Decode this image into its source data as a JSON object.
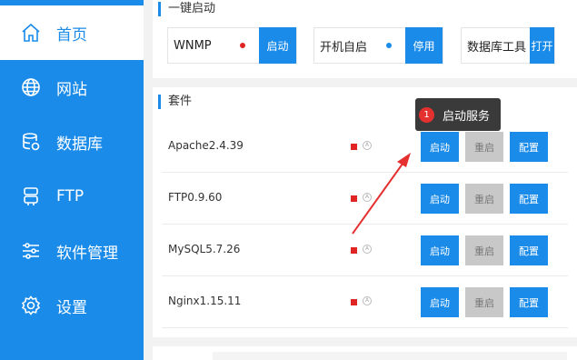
{
  "sidebar": {
    "items": [
      {
        "label": "首页",
        "icon": "home-icon",
        "active": true
      },
      {
        "label": "网站",
        "icon": "globe-icon",
        "active": false
      },
      {
        "label": "数据库",
        "icon": "database-icon",
        "active": false
      },
      {
        "label": "FTP",
        "icon": "ftp-icon",
        "active": false
      },
      {
        "label": "软件管理",
        "icon": "sliders-icon",
        "active": false
      },
      {
        "label": "设置",
        "icon": "gear-icon",
        "active": false
      }
    ]
  },
  "quick_launch": {
    "title": "一键启动",
    "groups": [
      {
        "name": "WNMP",
        "button": "启动",
        "dot_color": "#e02424"
      },
      {
        "name": "开机自启",
        "button": "停用",
        "dot_color": "#1b8be9"
      },
      {
        "name": "数据库工具",
        "button": "打开"
      }
    ]
  },
  "kits": {
    "title": "套件",
    "rows": [
      {
        "name": "Apache2.4.39",
        "status_ring": "A",
        "start": "启动",
        "restart": "重启",
        "config": "配置"
      },
      {
        "name": "FTP0.9.60",
        "status_ring": "A",
        "start": "启动",
        "restart": "重启",
        "config": "配置"
      },
      {
        "name": "MySQL5.7.26",
        "status_ring": "A",
        "start": "启动",
        "restart": "重启",
        "config": "配置"
      },
      {
        "name": "Nginx1.15.11",
        "status_ring": "A",
        "start": "启动",
        "restart": "重启",
        "config": "配置"
      }
    ]
  },
  "tooltip": {
    "badge": "1",
    "text": "启动服务"
  },
  "colors": {
    "accent": "#1b8be9",
    "stopped": "#e02424",
    "restart_bg": "#c8c8c8",
    "tooltip_bg": "#3a3a3a",
    "arrow": "#e53030"
  }
}
